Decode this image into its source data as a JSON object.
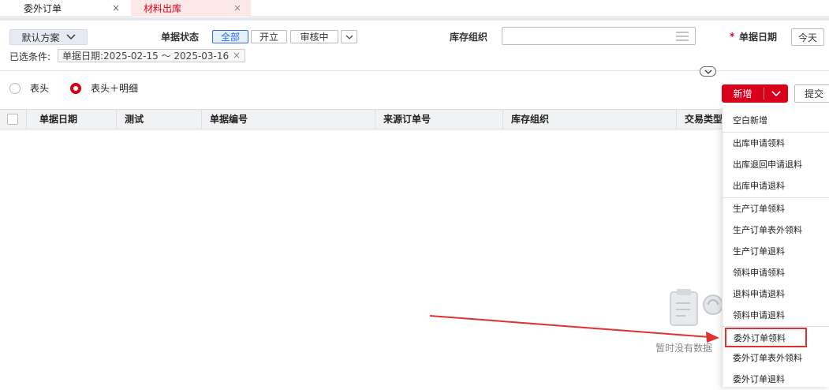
{
  "tabs": [
    {
      "label": "委外订单",
      "close": "×"
    },
    {
      "label": "材料出库",
      "close": "×"
    }
  ],
  "filter": {
    "scheme_label": "默认方案",
    "status_label": "单据状态",
    "status_options": [
      "全部",
      "开立",
      "审核中"
    ],
    "org_label": "库存组织",
    "org_value": "",
    "required_mark": "*",
    "date_label": "单据日期",
    "date_quick": "今天",
    "selected_label": "已选条件:",
    "selected_chip": "单据日期:2025-02-15 ～ 2025-03-16",
    "chip_close": "×"
  },
  "view": {
    "option_header": "表头",
    "option_header_detail": "表头＋明细",
    "selected": "表头＋明细"
  },
  "actions": {
    "new_label": "新增",
    "submit_label": "提交"
  },
  "table": {
    "columns": [
      "单据日期",
      "测试",
      "单据编号",
      "来源订单号",
      "库存组织",
      "交易类型"
    ]
  },
  "empty": {
    "text": "暂时没有数据"
  },
  "menu": {
    "items": [
      "空白新增",
      "出库申请领料",
      "出库退回申请退料",
      "出库申请退料",
      "生产订单领料",
      "生产订单表外领料",
      "生产订单退料",
      "领料申请领料",
      "退料申请退料",
      "领料申请退料",
      "委外订单领料",
      "委外订单表外领料",
      "委外订单退料"
    ],
    "highlighted": "委外订单领料"
  },
  "colors": {
    "accent_red": "#d9001b",
    "primary_blue": "#2f6ee0",
    "highlight_border": "#e23030",
    "arrow": "#e23030"
  }
}
